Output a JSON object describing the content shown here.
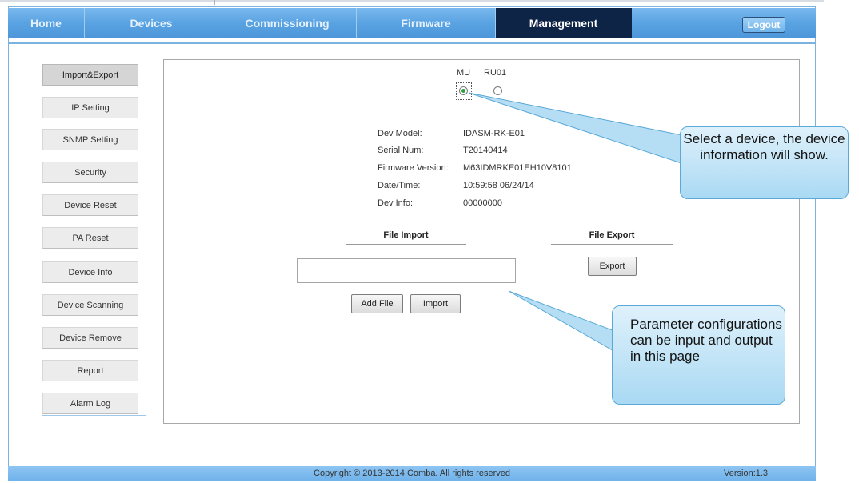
{
  "nav": {
    "items": [
      {
        "label": "Home"
      },
      {
        "label": "Devices"
      },
      {
        "label": "Commissioning"
      },
      {
        "label": "Firmware"
      },
      {
        "label": "Management",
        "active": true
      }
    ],
    "logout_label": "Logout"
  },
  "sidebar": {
    "items": [
      {
        "label": "Import&Export",
        "active": true
      },
      {
        "label": "IP Setting"
      },
      {
        "label": "SNMP Setting"
      },
      {
        "label": "Security"
      },
      {
        "label": "Device Reset"
      },
      {
        "label": "PA Reset"
      },
      {
        "label": "Device Info"
      },
      {
        "label": "Device Scanning"
      },
      {
        "label": "Device Remove"
      },
      {
        "label": "Report"
      },
      {
        "label": "Alarm Log"
      }
    ]
  },
  "device_select": {
    "options": [
      {
        "label": "MU",
        "selected": true
      },
      {
        "label": "RU01",
        "selected": false
      }
    ]
  },
  "device_info": {
    "rows": [
      {
        "key": "Dev Model:",
        "value": "IDASM-RK-E01"
      },
      {
        "key": "Serial Num:",
        "value": "T20140414"
      },
      {
        "key": "Firmware Version:",
        "value": "M63IDMRKE01EH10V8101"
      },
      {
        "key": "Date/Time:",
        "value": "10:59:58 06/24/14"
      },
      {
        "key": "Dev Info:",
        "value": "00000000"
      }
    ]
  },
  "file_import": {
    "title": "File Import",
    "file_value": "",
    "add_file_label": "Add File",
    "import_label": "Import"
  },
  "file_export": {
    "title": "File Export",
    "export_label": "Export"
  },
  "callouts": {
    "select_device": "Select a device, the device information will show.",
    "parameters": "Parameter configurations can be input and output in this page"
  },
  "footer": {
    "copyright": "Copyright © 2013-2014 Comba. All rights reserved",
    "version": "Version:1.3"
  },
  "colors": {
    "nav_bar": "#5aa3e2",
    "nav_active": "#0d2447",
    "radio_checked": "#2f9e42",
    "callout_fill": "#a9d9f3",
    "footer_bar": "#7fbcee"
  }
}
